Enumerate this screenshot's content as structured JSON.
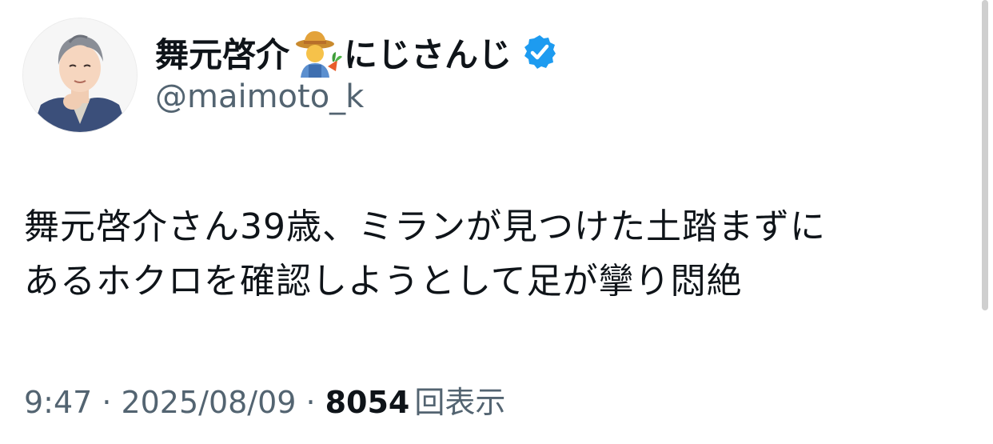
{
  "author": {
    "display_name_part1": "舞元啓介",
    "display_name_part2": "にじさんじ",
    "name_emoji": "farmer-emoji",
    "verified_icon": "verified-badge-icon",
    "handle": "@maimoto_k"
  },
  "tweet": {
    "line1": "舞元啓介さん39歳、ミランが見つけた土踏まずに",
    "line2": "あるホクロを確認しようとして足が攣り悶絶"
  },
  "meta": {
    "time": "9:47",
    "separator": "·",
    "date": "2025/08/09",
    "views_count": "8054",
    "views_label": "回表示"
  },
  "colors": {
    "text_primary": "#0f1419",
    "text_secondary": "#536471",
    "verified_blue": "#1d9bf0"
  }
}
